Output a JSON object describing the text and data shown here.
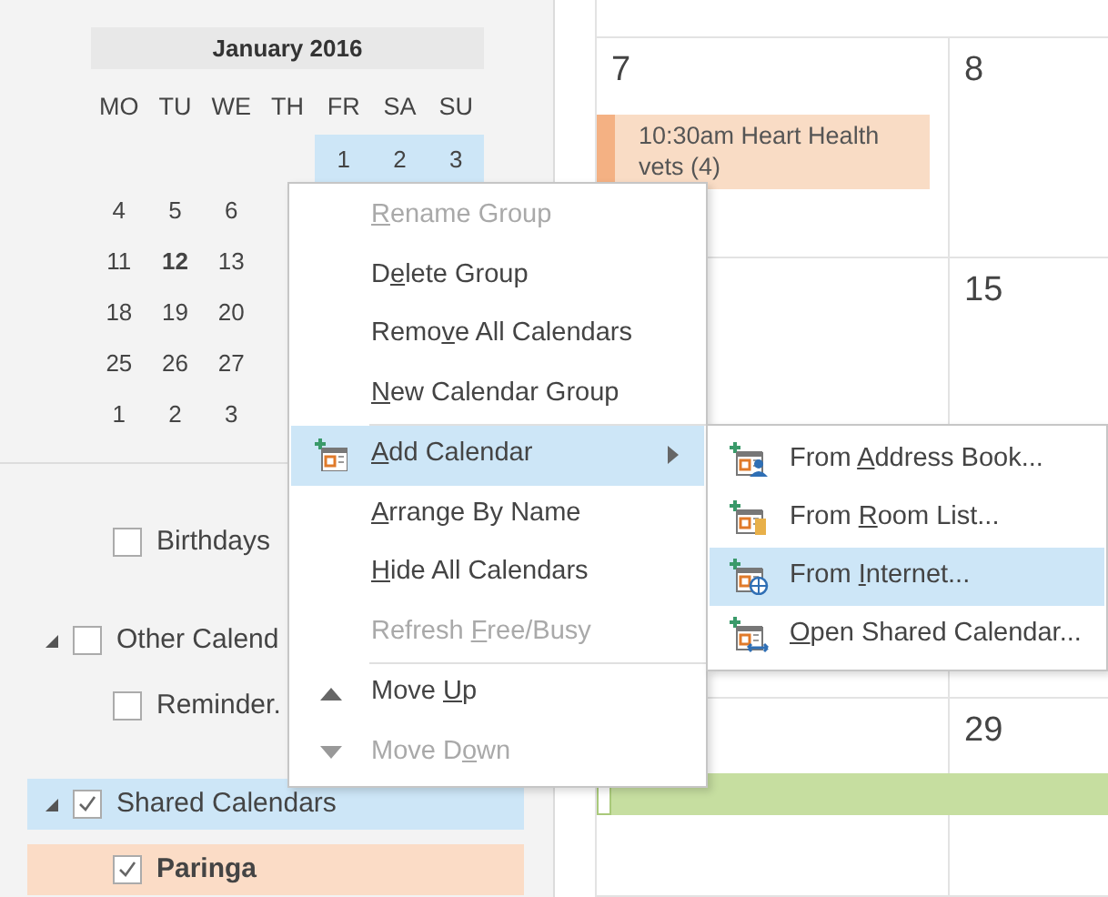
{
  "mini_calendar": {
    "title": "January 2016",
    "weekdays": [
      "MO",
      "TU",
      "WE",
      "TH",
      "FR",
      "SA",
      "SU"
    ],
    "weeks": [
      {
        "kind": "first",
        "selected": true,
        "days": [
          {
            "day": "1",
            "bold": false
          },
          {
            "day": "2",
            "bold": false
          },
          {
            "day": "3",
            "bold": false
          }
        ]
      },
      {
        "selected": false,
        "days": [
          {
            "day": "4",
            "bold": false
          },
          {
            "day": "5",
            "bold": false
          },
          {
            "day": "6",
            "bold": false
          }
        ]
      },
      {
        "selected": false,
        "days": [
          {
            "day": "11",
            "bold": false
          },
          {
            "day": "12",
            "bold": true
          },
          {
            "day": "13",
            "bold": false
          }
        ]
      },
      {
        "selected": false,
        "days": [
          {
            "day": "18",
            "bold": false
          },
          {
            "day": "19",
            "bold": false
          },
          {
            "day": "20",
            "bold": false
          }
        ]
      },
      {
        "selected": false,
        "days": [
          {
            "day": "25",
            "bold": false
          },
          {
            "day": "26",
            "bold": false
          },
          {
            "day": "27",
            "bold": false
          }
        ]
      },
      {
        "selected": false,
        "days": [
          {
            "day": "1",
            "bold": false
          },
          {
            "day": "2",
            "bold": false
          },
          {
            "day": "3",
            "bold": false
          }
        ]
      }
    ]
  },
  "calendar_tree": [
    {
      "children": [
        {
          "label": "Birthdays",
          "checked": false,
          "bold": false
        }
      ]
    },
    {
      "label": "Other Calend",
      "expanded": true,
      "checked": false,
      "selected": false,
      "children": [
        {
          "label": "Reminder.",
          "checked": false,
          "bold": false
        }
      ]
    },
    {
      "label": "Shared Calendars",
      "expanded": true,
      "checked": true,
      "selected": true,
      "children": [
        {
          "label": "Paringa",
          "checked": true,
          "bold": true,
          "color": "#fbdcc6"
        }
      ]
    }
  ],
  "month_grid": {
    "weeks": [
      {
        "kind": "week",
        "column_1": "7",
        "column_2": "8",
        "events": [
          {
            "kind": "timed",
            "text": "10:30am Heart Health vets (4)",
            "color": "#f9dcc5"
          }
        ]
      },
      {
        "kind": "week",
        "column_2": "15"
      },
      {
        "kind": "blank"
      },
      {
        "kind": "week",
        "column_2": "29",
        "events": [
          {
            "kind": "allday",
            "color": "#c6dea0"
          }
        ]
      }
    ]
  },
  "context_menu": [
    {
      "kind": "item",
      "key": "R",
      "after": "ename Group",
      "disabled": true,
      "selected": false
    },
    {
      "kind": "item",
      "before": "D",
      "key": "e",
      "after": "lete Group",
      "disabled": false,
      "selected": false
    },
    {
      "kind": "item",
      "before": "Remo",
      "key": "v",
      "after": "e All Calendars",
      "disabled": false,
      "selected": false
    },
    {
      "kind": "item",
      "key": "N",
      "after": "ew Calendar Group",
      "disabled": false,
      "selected": false
    },
    {
      "kind": "separator"
    },
    {
      "kind": "submenu",
      "key": "A",
      "after": "dd Calendar",
      "disabled": false,
      "selected": true
    },
    {
      "kind": "item",
      "key": "A",
      "after": "rrange By Name",
      "disabled": false,
      "selected": false
    },
    {
      "kind": "item",
      "key": "H",
      "after": "ide All Calendars",
      "disabled": false,
      "selected": false
    },
    {
      "kind": "item",
      "before": "Refresh ",
      "key": "F",
      "after": "ree/Busy",
      "disabled": true,
      "selected": false
    },
    {
      "kind": "separator"
    },
    {
      "kind": "item",
      "before": "Move ",
      "key": "U",
      "after": "p",
      "disabled": false,
      "selected": false
    },
    {
      "kind": "item",
      "before": "Move D",
      "key": "o",
      "after": "wn",
      "disabled": true,
      "selected": false
    }
  ],
  "submenu": [
    {
      "before": "From ",
      "key": "A",
      "after": "ddress Book...",
      "selected": false
    },
    {
      "before": "From ",
      "key": "R",
      "after": "oom List...",
      "selected": false
    },
    {
      "before": "From ",
      "key": "I",
      "after": "nternet...",
      "selected": true
    },
    {
      "key": "O",
      "after": "pen Shared Calendar...",
      "selected": false
    }
  ]
}
